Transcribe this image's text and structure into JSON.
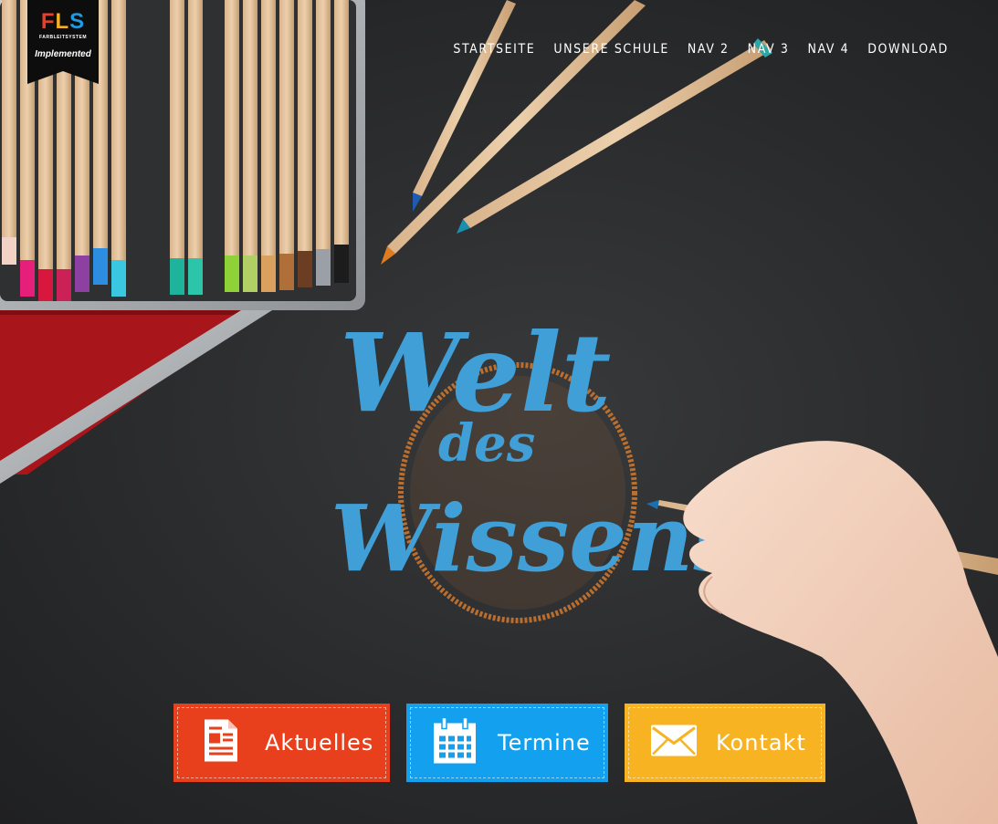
{
  "logo": {
    "mark": [
      "F",
      "L",
      "S"
    ],
    "subtitle": "FARBLEITSYSTEM",
    "tagline": "Implemented"
  },
  "nav": {
    "items": [
      "STARTSEITE",
      "UNSERE SCHULE",
      "NAV 2",
      "NAV 3",
      "NAV 4",
      "DOWNLOAD"
    ]
  },
  "hero": {
    "lettering": [
      "Welt",
      "des",
      "Wissens"
    ]
  },
  "actions": {
    "news_label": "Aktuelles",
    "dates_label": "Termine",
    "contact_label": "Kontakt"
  },
  "colors": {
    "news": "#e8401c",
    "dates": "#12a0ef",
    "contact": "#f7b321",
    "chalk_blue": "#3f9fd6",
    "chalk_orange": "#c9762f"
  },
  "icons": {
    "news": "document-icon",
    "dates": "calendar-icon",
    "contact": "envelope-icon"
  }
}
